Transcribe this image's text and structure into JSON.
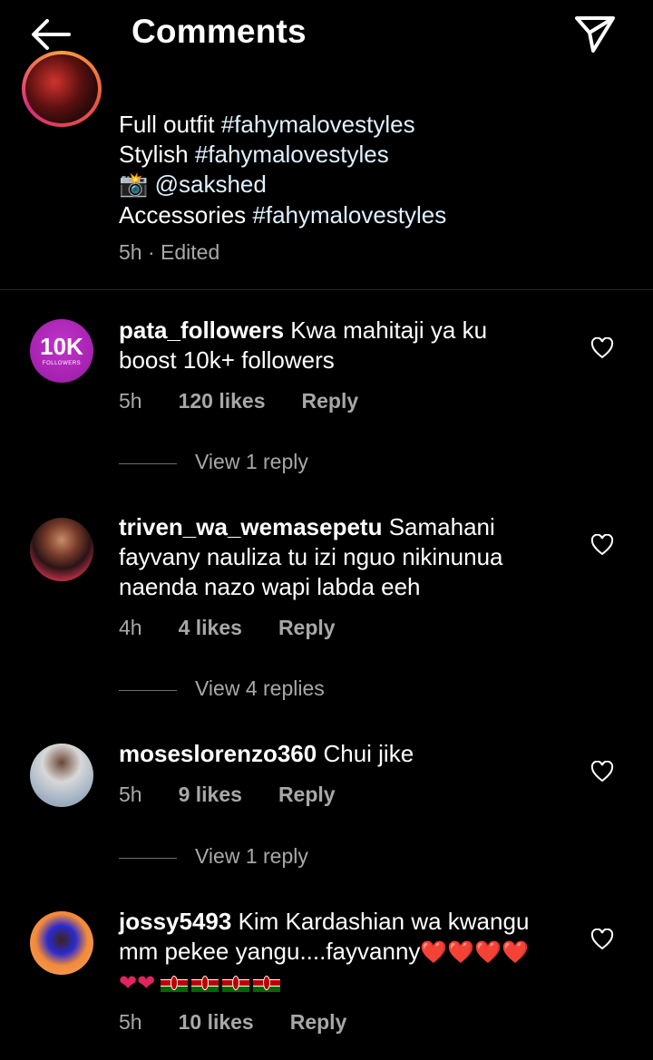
{
  "header": {
    "title": "Comments",
    "back_icon": "arrow-left-icon",
    "share_icon": "paper-plane-icon"
  },
  "caption": {
    "lines": [
      {
        "text": "Full outfit ",
        "tag": "#fahymalovestyles"
      },
      {
        "text": "Stylish ",
        "tag": "#fahymalovestyles"
      },
      {
        "emoji": "📸",
        "text": " @sakshed"
      },
      {
        "text": "Accessories ",
        "tag": "#fahymalovestyles"
      }
    ],
    "meta": "5h · Edited"
  },
  "comments": [
    {
      "username": "pata_followers",
      "lines": [
        "Kwa mahitaji ya ku",
        "boost 10k+ followers"
      ],
      "time": "5h",
      "likes": "120 likes",
      "reply": "Reply",
      "view_replies": "View 1 reply",
      "avatar_text": "10K",
      "avatar_subtext": "FOLLOWERS"
    },
    {
      "username": "triven_wa_wemasepetu",
      "lines": [
        "Samahani",
        "fayvany nauliza tu izi nguo nikinunua",
        "naenda nazo wapi labda eeh"
      ],
      "time": "4h",
      "likes": "4 likes",
      "reply": "Reply",
      "view_replies": "View 4 replies"
    },
    {
      "username": "moseslorenzo360",
      "lines": [
        "Chui jike"
      ],
      "time": "5h",
      "likes": "9 likes",
      "reply": "Reply",
      "view_replies": "View 1 reply"
    },
    {
      "username": "jossy5493",
      "lines": [
        "Kim Kardashian wa kwangu",
        "mm pekee yangu....fayvanny",
        "❤️❤️🇰🇪🇰🇪🇰🇪🇰🇪"
      ],
      "line2_hearts": "❤️❤️❤️❤️",
      "time": "5h",
      "likes": "10 likes",
      "reply": "Reply"
    }
  ],
  "colors": {
    "background": "#000000",
    "muted": "#a8a8a8",
    "divider": "#262626",
    "heart_red": "#e0245e"
  }
}
